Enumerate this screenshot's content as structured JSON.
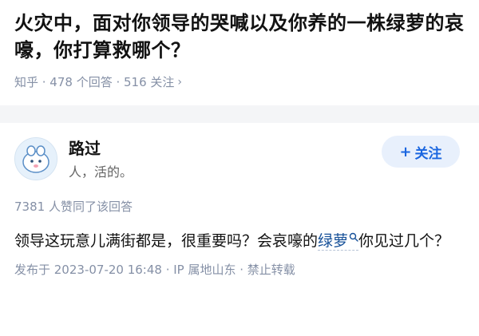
{
  "question": {
    "title": "火灾中，面对你领导的哭喊以及你养的一株绿萝的哀嚎，你打算救哪个？",
    "meta": "知乎 · 478 个回答 · 516 关注",
    "meta_chevron": "›"
  },
  "answer": {
    "author": {
      "name": "路过",
      "bio": "人，活的。",
      "follow_label": "关注",
      "follow_plus": "+"
    },
    "likes_text": "7381 人赞同了该回答",
    "body_before": "领导这玩意儿满街都是，很重要吗？会哀嚎的",
    "body_keyword": "绿萝",
    "body_after": "你见过几个？",
    "footer": "发布于 2023-07-20 16:48 · IP 属地山东 · 禁止转载"
  }
}
